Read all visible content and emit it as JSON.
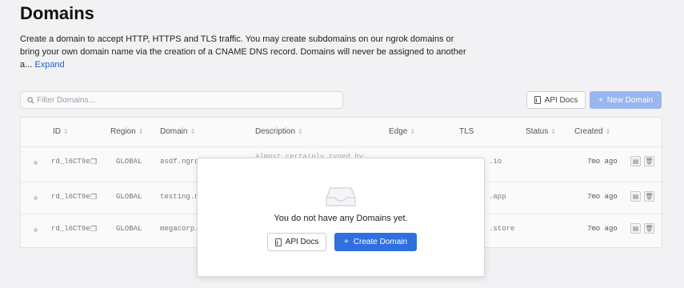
{
  "page": {
    "title": "Domains",
    "description": "Create a domain to accept HTTP, HTTPS and TLS traffic. You may create subdomains on our ngrok domains or bring your own domain name via the creation of a CNAME DNS record. Domains will never be assigned to another a...",
    "expand_label": "Expand"
  },
  "toolbar": {
    "filter_placeholder": "Filter Domains...",
    "api_docs_label": "API Docs",
    "new_domain_label": "New Domain"
  },
  "table": {
    "headers": [
      "ID",
      "Region",
      "Domain",
      "Description",
      "Edge",
      "TLS",
      "Status",
      "Created"
    ],
    "rows": [
      {
        "id": "rd_l6CT9e",
        "region": "GLOBAL",
        "domain": "asdf.ngro",
        "description_partial": "Almost certainly typed by",
        "tls": ".io",
        "created": "7mo ago"
      },
      {
        "id": "rd_l6CT9e",
        "region": "GLOBAL",
        "domain": "testing.n",
        "description_partial": "",
        "tls": ".app",
        "created": "7mo ago"
      },
      {
        "id": "rd_l6CT9e",
        "region": "GLOBAL",
        "domain": "megacorp.",
        "description_partial": "",
        "tls": ".store",
        "created": "7mo ago"
      }
    ]
  },
  "empty_modal": {
    "message": "You do not have any Domains yet.",
    "api_docs_label": "API Docs",
    "create_label": "Create Domain"
  },
  "colors": {
    "accent": "#2f6fe0",
    "accent_disabled": "#9ab6ee",
    "link": "#1f5cd6"
  }
}
